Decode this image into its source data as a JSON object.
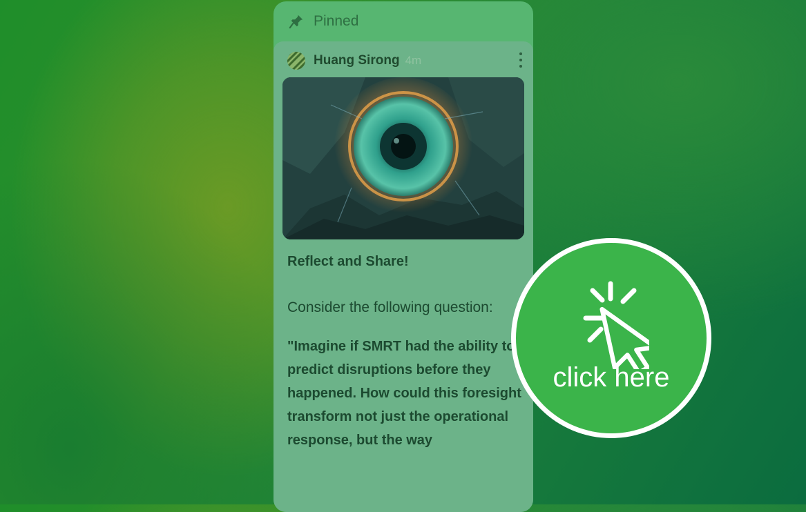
{
  "pinned": {
    "label": "Pinned",
    "icon": "pin-icon"
  },
  "post": {
    "author": "Huang Sirong",
    "time": "4m",
    "title": "Reflect and Share!",
    "body": "Consider the following question:",
    "quote": "\"Imagine if SMRT had the ability to predict disruptions before they happened. How could this foresight transform not just the operational response, but the way",
    "image_subject": "eye-image",
    "menu_icon": "more-vertical-icon"
  },
  "cta": {
    "label": "click here",
    "icon": "cursor-click-icon",
    "color": "#3bb44a"
  },
  "colors": {
    "panel": "#57b671",
    "card": "#6cb389",
    "text": "#1c4a30"
  }
}
